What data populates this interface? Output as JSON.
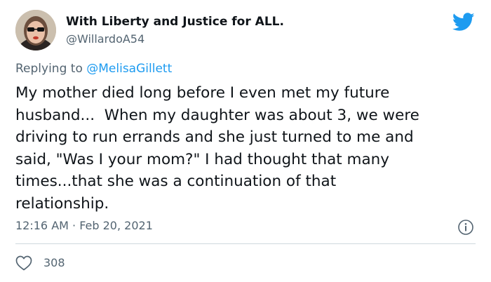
{
  "author": {
    "display_name": "With Liberty and Justice for ALL.",
    "handle": "@WillardoA54",
    "avatar_icon": "avatar-photo"
  },
  "brand": {
    "icon": "twitter-bird-icon",
    "color": "#1d9bf0"
  },
  "reply": {
    "prefix": "Replying to ",
    "mention": "@MelisaGillett"
  },
  "tweet": {
    "lines": [
      "My mother died long before I even met my future",
      "husband...  When my daughter was about 3, we were",
      "driving to run errands and she just turned to me and",
      "said, \"Was I your mom?\" I had thought that many",
      "times...that she was a continuation of that",
      "relationship."
    ],
    "timestamp": "12:16 AM · Feb 20, 2021"
  },
  "engagement": {
    "like_icon": "heart-icon",
    "likes": "308",
    "info_icon": "info-icon"
  },
  "colors": {
    "text": "#0f1419",
    "secondary": "#536471",
    "accent": "#1d9bf0",
    "divider": "#cfd9de"
  }
}
